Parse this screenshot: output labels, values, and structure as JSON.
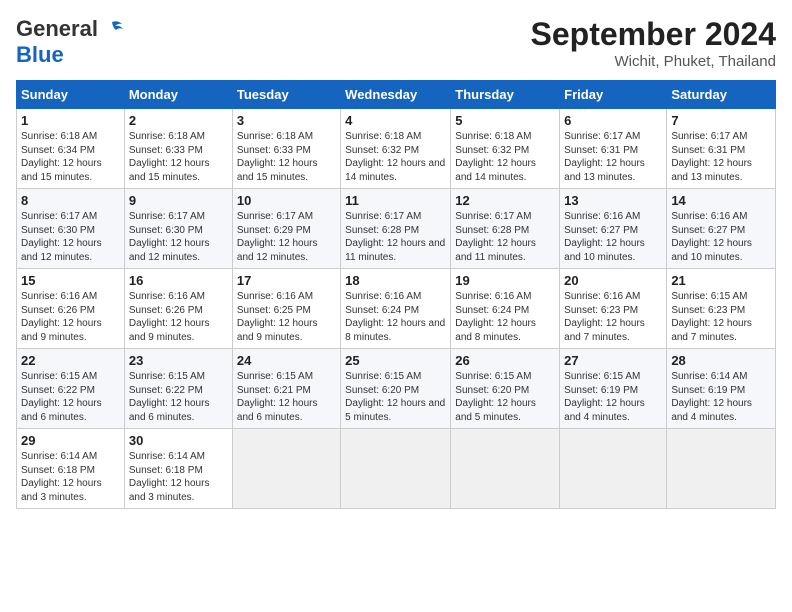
{
  "logo": {
    "line1": "General",
    "line2": "Blue"
  },
  "title": "September 2024",
  "subtitle": "Wichit, Phuket, Thailand",
  "days_of_week": [
    "Sunday",
    "Monday",
    "Tuesday",
    "Wednesday",
    "Thursday",
    "Friday",
    "Saturday"
  ],
  "weeks": [
    [
      {
        "day": "1",
        "sunrise": "6:18 AM",
        "sunset": "6:34 PM",
        "daylight": "12 hours and 15 minutes."
      },
      {
        "day": "2",
        "sunrise": "6:18 AM",
        "sunset": "6:33 PM",
        "daylight": "12 hours and 15 minutes."
      },
      {
        "day": "3",
        "sunrise": "6:18 AM",
        "sunset": "6:33 PM",
        "daylight": "12 hours and 15 minutes."
      },
      {
        "day": "4",
        "sunrise": "6:18 AM",
        "sunset": "6:32 PM",
        "daylight": "12 hours and 14 minutes."
      },
      {
        "day": "5",
        "sunrise": "6:18 AM",
        "sunset": "6:32 PM",
        "daylight": "12 hours and 14 minutes."
      },
      {
        "day": "6",
        "sunrise": "6:17 AM",
        "sunset": "6:31 PM",
        "daylight": "12 hours and 13 minutes."
      },
      {
        "day": "7",
        "sunrise": "6:17 AM",
        "sunset": "6:31 PM",
        "daylight": "12 hours and 13 minutes."
      }
    ],
    [
      {
        "day": "8",
        "sunrise": "6:17 AM",
        "sunset": "6:30 PM",
        "daylight": "12 hours and 12 minutes."
      },
      {
        "day": "9",
        "sunrise": "6:17 AM",
        "sunset": "6:30 PM",
        "daylight": "12 hours and 12 minutes."
      },
      {
        "day": "10",
        "sunrise": "6:17 AM",
        "sunset": "6:29 PM",
        "daylight": "12 hours and 12 minutes."
      },
      {
        "day": "11",
        "sunrise": "6:17 AM",
        "sunset": "6:28 PM",
        "daylight": "12 hours and 11 minutes."
      },
      {
        "day": "12",
        "sunrise": "6:17 AM",
        "sunset": "6:28 PM",
        "daylight": "12 hours and 11 minutes."
      },
      {
        "day": "13",
        "sunrise": "6:16 AM",
        "sunset": "6:27 PM",
        "daylight": "12 hours and 10 minutes."
      },
      {
        "day": "14",
        "sunrise": "6:16 AM",
        "sunset": "6:27 PM",
        "daylight": "12 hours and 10 minutes."
      }
    ],
    [
      {
        "day": "15",
        "sunrise": "6:16 AM",
        "sunset": "6:26 PM",
        "daylight": "12 hours and 9 minutes."
      },
      {
        "day": "16",
        "sunrise": "6:16 AM",
        "sunset": "6:26 PM",
        "daylight": "12 hours and 9 minutes."
      },
      {
        "day": "17",
        "sunrise": "6:16 AM",
        "sunset": "6:25 PM",
        "daylight": "12 hours and 9 minutes."
      },
      {
        "day": "18",
        "sunrise": "6:16 AM",
        "sunset": "6:24 PM",
        "daylight": "12 hours and 8 minutes."
      },
      {
        "day": "19",
        "sunrise": "6:16 AM",
        "sunset": "6:24 PM",
        "daylight": "12 hours and 8 minutes."
      },
      {
        "day": "20",
        "sunrise": "6:16 AM",
        "sunset": "6:23 PM",
        "daylight": "12 hours and 7 minutes."
      },
      {
        "day": "21",
        "sunrise": "6:15 AM",
        "sunset": "6:23 PM",
        "daylight": "12 hours and 7 minutes."
      }
    ],
    [
      {
        "day": "22",
        "sunrise": "6:15 AM",
        "sunset": "6:22 PM",
        "daylight": "12 hours and 6 minutes."
      },
      {
        "day": "23",
        "sunrise": "6:15 AM",
        "sunset": "6:22 PM",
        "daylight": "12 hours and 6 minutes."
      },
      {
        "day": "24",
        "sunrise": "6:15 AM",
        "sunset": "6:21 PM",
        "daylight": "12 hours and 6 minutes."
      },
      {
        "day": "25",
        "sunrise": "6:15 AM",
        "sunset": "6:20 PM",
        "daylight": "12 hours and 5 minutes."
      },
      {
        "day": "26",
        "sunrise": "6:15 AM",
        "sunset": "6:20 PM",
        "daylight": "12 hours and 5 minutes."
      },
      {
        "day": "27",
        "sunrise": "6:15 AM",
        "sunset": "6:19 PM",
        "daylight": "12 hours and 4 minutes."
      },
      {
        "day": "28",
        "sunrise": "6:14 AM",
        "sunset": "6:19 PM",
        "daylight": "12 hours and 4 minutes."
      }
    ],
    [
      {
        "day": "29",
        "sunrise": "6:14 AM",
        "sunset": "6:18 PM",
        "daylight": "12 hours and 3 minutes."
      },
      {
        "day": "30",
        "sunrise": "6:14 AM",
        "sunset": "6:18 PM",
        "daylight": "12 hours and 3 minutes."
      },
      null,
      null,
      null,
      null,
      null
    ]
  ],
  "labels": {
    "sunrise": "Sunrise:",
    "sunset": "Sunset:",
    "daylight": "Daylight:"
  }
}
